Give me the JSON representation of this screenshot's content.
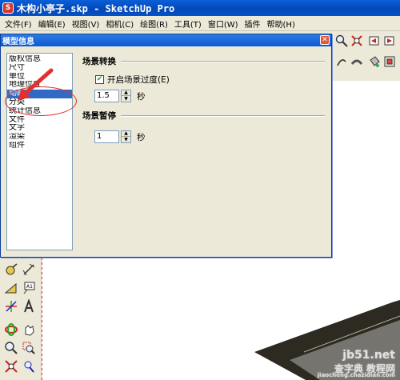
{
  "app": {
    "title": "木构小亭子.skp - SketchUp Pro"
  },
  "menu": [
    "文件(F)",
    "编辑(E)",
    "视图(V)",
    "相机(C)",
    "绘图(R)",
    "工具(T)",
    "窗口(W)",
    "插件",
    "帮助(H)"
  ],
  "dialog": {
    "title": "模型信息",
    "categories": [
      "版权信息",
      "尺寸",
      "单位",
      "地理位置",
      "动画",
      "分类",
      "统计信息",
      "文件",
      "文字",
      "渲染",
      "组件"
    ],
    "selected_category": "动画",
    "scene_transition": {
      "title": "场景转换",
      "checkbox_label": "开启场景过度(E)",
      "checked": true,
      "value": "1.5",
      "unit": "秒"
    },
    "scene_delay": {
      "title": "场景暂停",
      "value": "1",
      "unit": "秒"
    }
  },
  "watermark": {
    "line1": "jb51.net",
    "line2": "查字典 教程网",
    "line3": "jiaocheng.chazidian.com"
  },
  "colors": {
    "title_bar": "#0448b8",
    "selection": "#316ac5",
    "annotation": "#e03030"
  }
}
